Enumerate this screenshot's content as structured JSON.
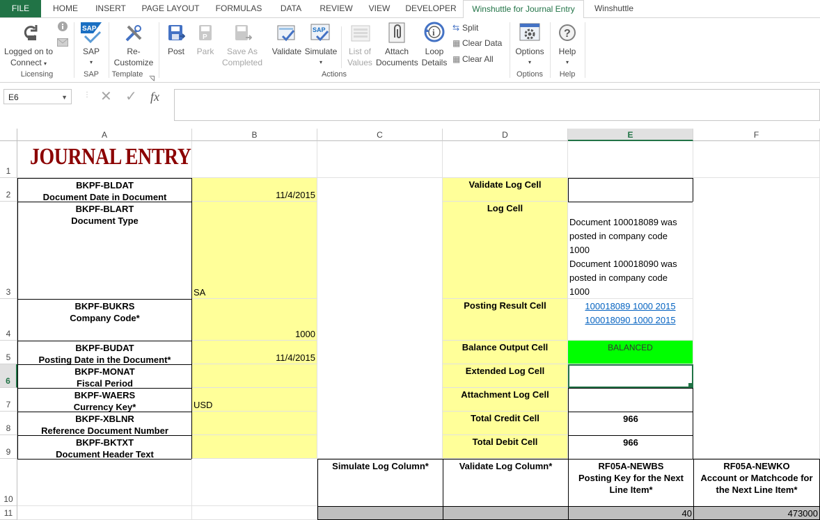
{
  "ribbon_tabs": [
    "FILE",
    "HOME",
    "INSERT",
    "PAGE LAYOUT",
    "FORMULAS",
    "DATA",
    "REVIEW",
    "VIEW",
    "DEVELOPER",
    "Winshuttle for Journal Entry",
    "Winshuttle"
  ],
  "ribbon": {
    "logged_on_line1": "Logged on to",
    "logged_on_line2": "Connect",
    "sap": "SAP",
    "recustomize_line1": "Re-",
    "recustomize_line2": "Customize",
    "post": "Post",
    "park": "Park",
    "save_line1": "Save As",
    "save_line2": "Completed",
    "validate": "Validate",
    "simulate": "Simulate",
    "list_line1": "List of",
    "list_line2": "Values",
    "attach_line1": "Attach",
    "attach_line2": "Documents",
    "loop_line1": "Loop",
    "loop_line2": "Details",
    "split": "Split",
    "clear_data": "Clear Data",
    "clear_all": "Clear All",
    "options": "Options",
    "help": "Help",
    "groups": {
      "licensing": "Licensing",
      "sap": "SAP",
      "template": "Template",
      "actions": "Actions",
      "options": "Options",
      "help": "Help"
    }
  },
  "formula_bar": {
    "name_box": "E6",
    "fx": "fx",
    "formula": ""
  },
  "columns": [
    "A",
    "B",
    "C",
    "D",
    "E",
    "F"
  ],
  "rows": [
    "1",
    "2",
    "3",
    "4",
    "5",
    "6",
    "7",
    "8",
    "9",
    "10",
    "11"
  ],
  "sheet": {
    "title": "JOURNAL ENTRY",
    "a2_1": "BKPF-BLDAT",
    "a2_2": "Document Date in Document",
    "a3_1": "BKPF-BLART",
    "a3_2": "Document Type",
    "a4_1": "BKPF-BUKRS",
    "a4_2": "Company Code*",
    "a5_1": "BKPF-BUDAT",
    "a5_2": "Posting Date in the Document*",
    "a6_1": "BKPF-MONAT",
    "a6_2": "Fiscal Period",
    "a7_1": "BKPF-WAERS",
    "a7_2": "Currency Key*",
    "a8_1": "BKPF-XBLNR",
    "a8_2": "Reference Document Number",
    "a9_1": "BKPF-BKTXT",
    "a9_2": "Document Header Text",
    "b2": "11/4/2015",
    "b3": "SA",
    "b4": "1000",
    "b5": "11/4/2015",
    "b7": "USD",
    "d2": "Validate Log Cell",
    "d3": "Log Cell",
    "d4": "Posting Result Cell",
    "d5": "Balance Output Cell",
    "d6": "Extended Log Cell",
    "d7": "Attachment Log Cell",
    "d8": "Total Credit Cell",
    "d9": "Total Debit Cell",
    "e3_1": "Document 100018089 was",
    "e3_2": "posted in company code",
    "e3_3": "1000",
    "e3_4": "Document 100018090 was",
    "e3_5": "posted in company code",
    "e3_6": "1000",
    "e4_1": "100018089 1000 2015",
    "e4_2": "100018090 1000 2015",
    "e5": "BALANCED",
    "e8": "966",
    "e9": "966",
    "c10": "Simulate Log Column*",
    "d10": "Validate Log Column*",
    "e10_1": "RF05A-NEWBS",
    "e10_2": "Posting Key for the Next",
    "e10_3": "Line Item*",
    "f10_1": "RF05A-NEWKO",
    "f10_2": "Account or Matchcode for",
    "f10_3": "the Next Line Item*",
    "e11": "40",
    "f11": "473000"
  },
  "colors": {
    "excel_green": "#217346",
    "input_yellow": "#ffff99",
    "balanced_green": "#00ff00",
    "title_red": "#8b0000"
  }
}
